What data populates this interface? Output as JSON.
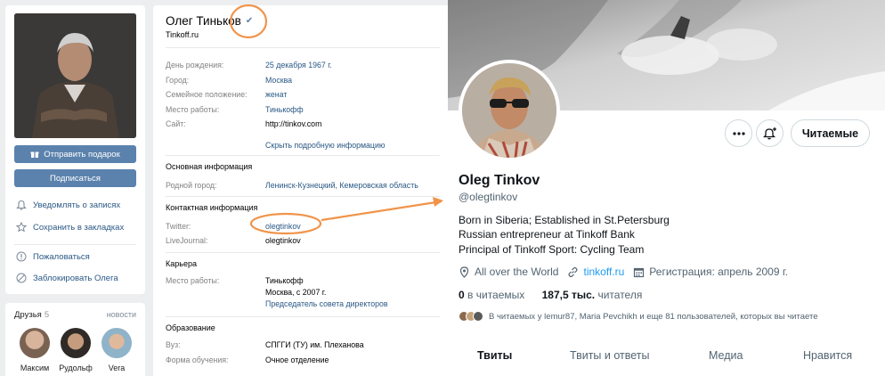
{
  "vk": {
    "left": {
      "buttons": {
        "gift": "Отправить подарок",
        "subscribe": "Подписаться"
      },
      "actions": {
        "notify": "Уведомлять о записях",
        "bookmark": "Сохранить в закладках",
        "report": "Пожаловаться",
        "block": "Заблокировать Олега"
      }
    },
    "friends": {
      "title": "Друзья",
      "count": "5",
      "all": "новости",
      "items": [
        {
          "name": "Максим"
        },
        {
          "name": "Рудольф"
        },
        {
          "name": "Vera"
        }
      ]
    },
    "profile": {
      "name": "Олег Тиньков",
      "status": "Tinkoff.ru",
      "rows": [
        {
          "label": "День рождения:",
          "value": "25 декабря 1967 г."
        },
        {
          "label": "Город:",
          "value": "Москва"
        },
        {
          "label": "Семейное положение:",
          "value": "женат"
        },
        {
          "label": "Место работы:",
          "value": "Тинькофф"
        },
        {
          "label": "Сайт:",
          "value": "http://tinkov.com"
        }
      ],
      "hide_link": "Скрыть подробную информацию",
      "basic": {
        "title": "Основная информация",
        "hometown_label": "Родной город:",
        "hometown_value": "Ленинск-Кузнецкий, Кемеровская область"
      },
      "contacts": {
        "title": "Контактная информация",
        "twitter_label": "Twitter:",
        "twitter_value": "olegtinkov",
        "lj_label": "LiveJournal:",
        "lj_value": "olegtinkov"
      },
      "career": {
        "title": "Карьера",
        "label": "Место работы:",
        "company": "Тинькофф",
        "period": "Москва, с 2007 г.",
        "position": "Председатель совета директоров"
      },
      "education": {
        "title": "Образование",
        "uni_label": "Вуз:",
        "uni_value": "СПГГИ (ТУ) им. Плеханова",
        "form_label": "Форма обучения:",
        "form_value": "Очное отделение"
      }
    }
  },
  "twitter": {
    "name": "Oleg Tinkov",
    "handle": "@olegtinkov",
    "follow_label": "Читаемые",
    "bio": [
      "Born in Siberia; Established in St.Petersburg",
      "Russian entrepreneur at Tinkoff Bank",
      "Principal of Tinkoff Sport: Cycling Team"
    ],
    "location": "All over the World",
    "website": "tinkoff.ru",
    "joined": "Регистрация: апрель 2009 г.",
    "following_count": "0",
    "following_label": "в читаемых",
    "followers_count": "187,5 тыс.",
    "followers_label": "читателя",
    "known_followers": "В читаемых у lemur87, Maria Pevchikh и еще 81 пользователей, которых вы читаете",
    "tabs": [
      "Твиты",
      "Твиты и ответы",
      "Медиа",
      "Нравится"
    ]
  },
  "colors": {
    "vk_blue": "#5b82ad",
    "vk_link": "#2a5885",
    "annotation": "#f0944a",
    "twitter_blue": "#1d9bf0"
  }
}
